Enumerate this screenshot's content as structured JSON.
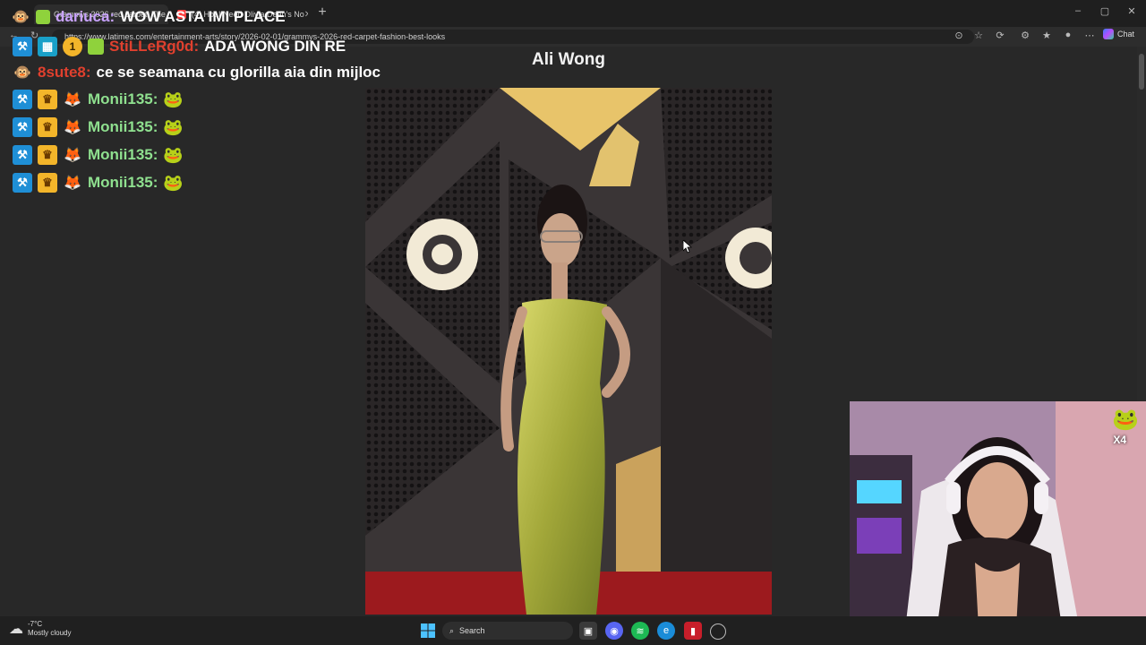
{
  "browser": {
    "tabs": [
      {
        "title": "Grammys 2026 red carpet: The be",
        "active": true
      },
      {
        "title": "(4) Hot I Need Olivia Dean's No",
        "active": false
      }
    ],
    "url": "https://www.latimes.com/entertainment-arts/story/2026-02-01/grammys-2026-red-carpet-fashion-best-looks",
    "chat_button": "Chat"
  },
  "page": {
    "title": "Ali Wong"
  },
  "chat": {
    "messages": [
      {
        "user": "dariuca:",
        "text": "WOW ASTA IMI PLACE",
        "user_color": "#c9a3ff"
      },
      {
        "user": "StiLLeRg0d:",
        "text": "ADA WONG DIN RE",
        "user_color": "#e0402e"
      },
      {
        "user": "8sute8:",
        "text": "ce se seamana cu glorilla aia din mijloc",
        "user_color": "#e0402e"
      },
      {
        "user": "Monii135:",
        "text": "",
        "user_color": "#8fe08f"
      },
      {
        "user": "Monii135:",
        "text": "",
        "user_color": "#8fe08f"
      },
      {
        "user": "Monii135:",
        "text": "",
        "user_color": "#8fe08f"
      },
      {
        "user": "Monii135:",
        "text": "",
        "user_color": "#8fe08f"
      }
    ]
  },
  "cam_overlay": {
    "multiplier": "X4"
  },
  "taskbar": {
    "weather_temp": "-7°C",
    "weather_desc": "Mostly cloudy",
    "search_placeholder": "Search"
  }
}
